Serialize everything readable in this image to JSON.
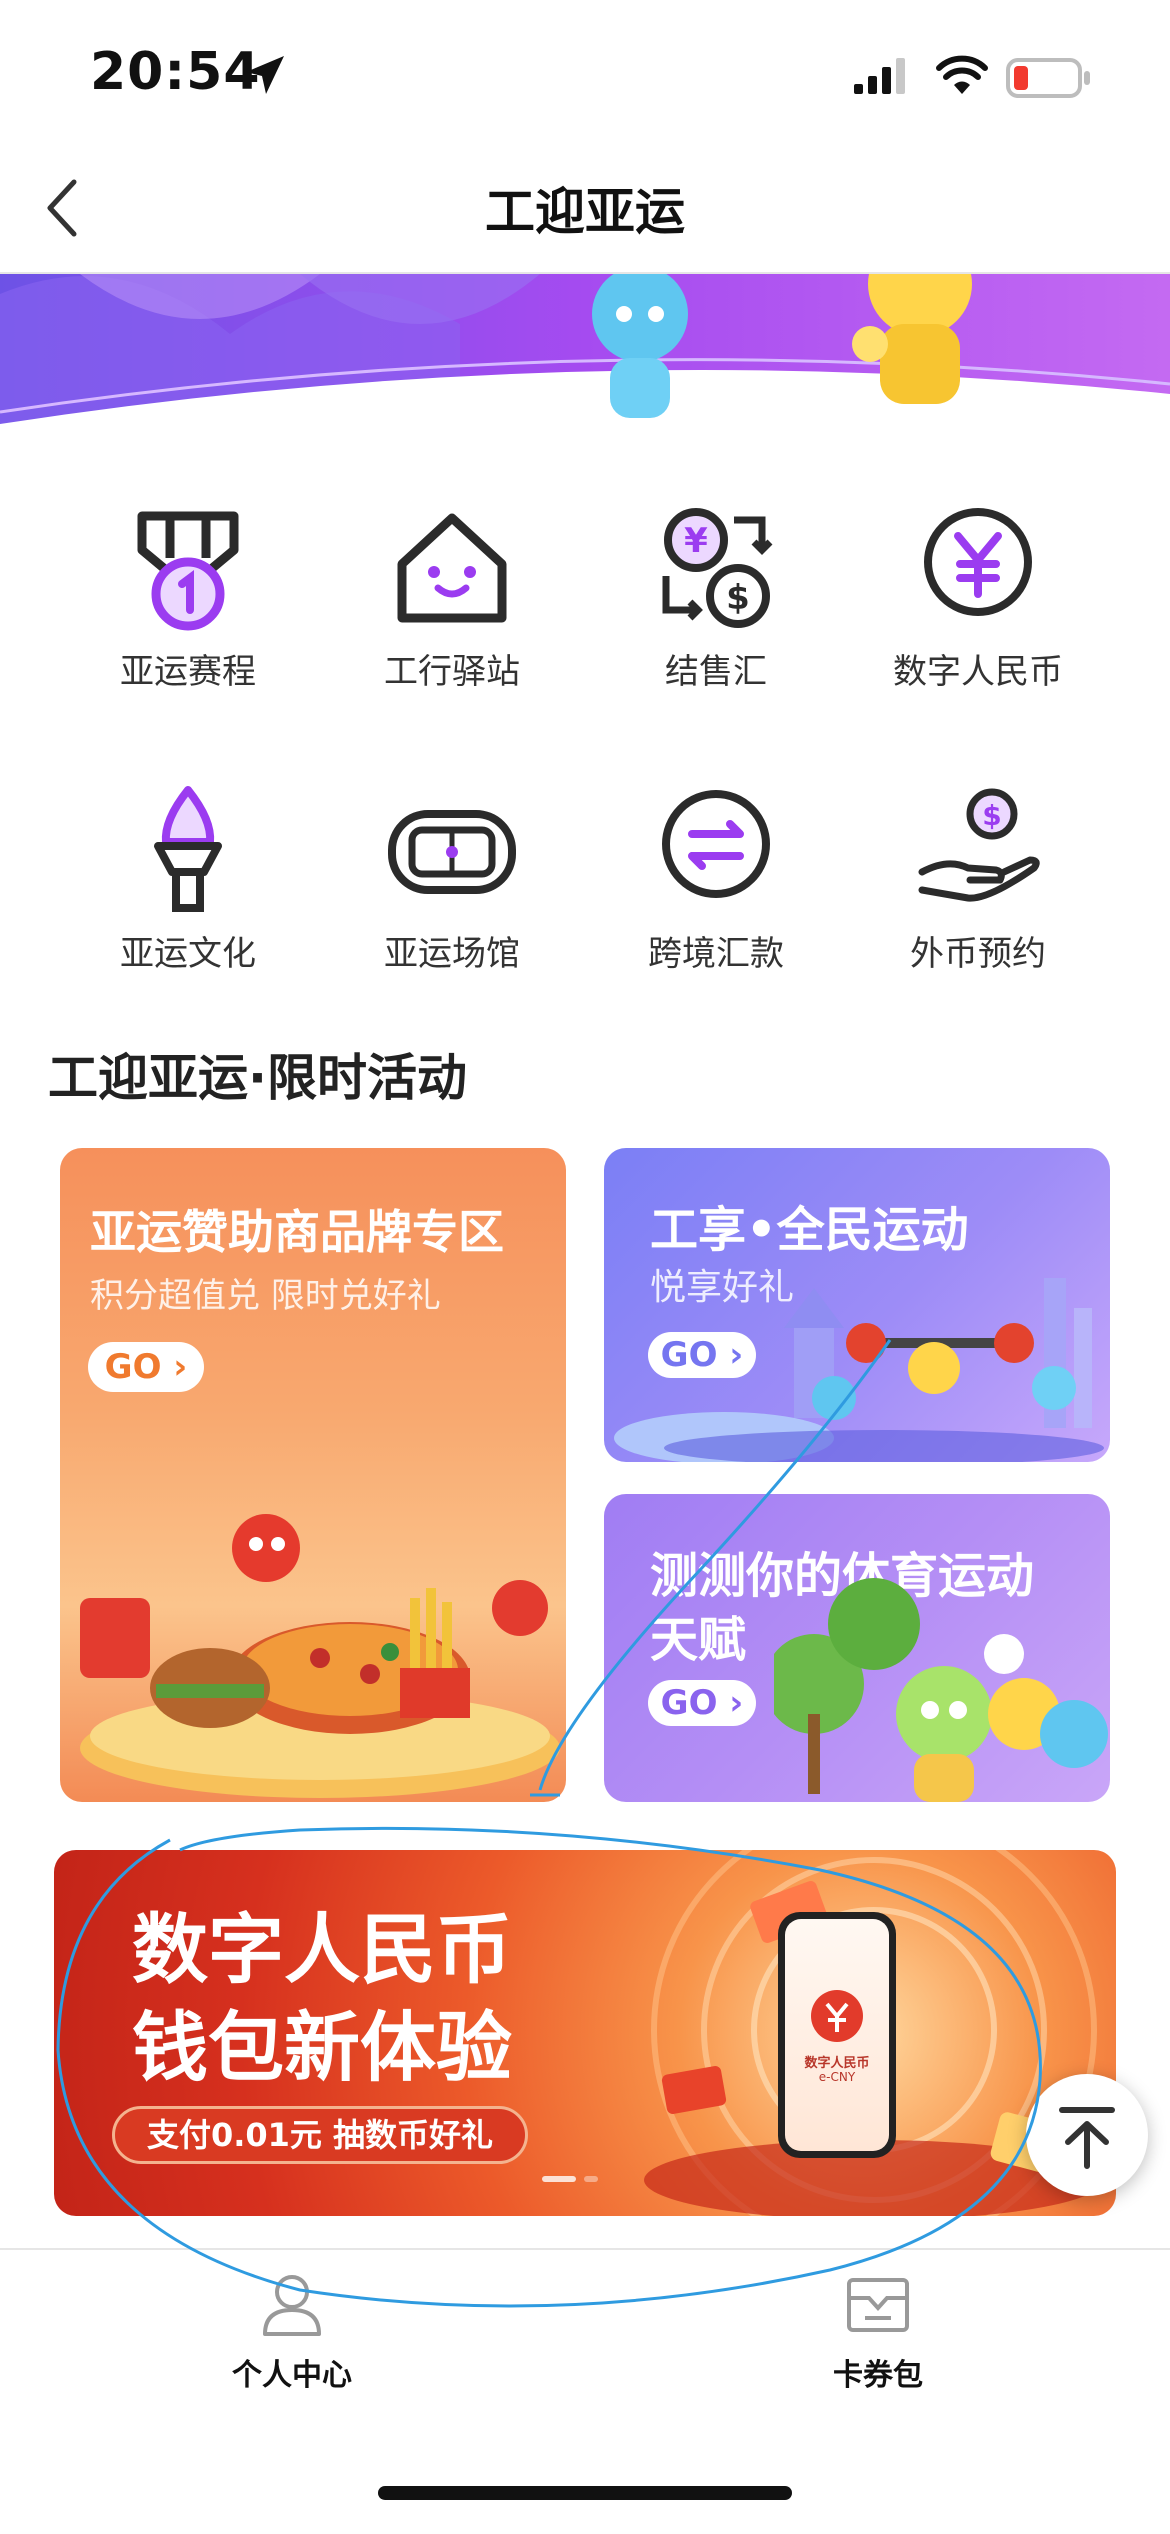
{
  "status_bar": {
    "time": "20:54"
  },
  "nav": {
    "title": "工迎亚运"
  },
  "grid": [
    {
      "label": "亚运赛程",
      "icon": "medal-icon"
    },
    {
      "label": "工行驿站",
      "icon": "house-icon"
    },
    {
      "label": "结售汇",
      "icon": "currency-exchange-icon"
    },
    {
      "label": "数字人民币",
      "icon": "yuan-coin-icon"
    },
    {
      "label": "亚运文化",
      "icon": "torch-icon"
    },
    {
      "label": "亚运场馆",
      "icon": "stadium-icon"
    },
    {
      "label": "跨境汇款",
      "icon": "transfer-arrows-icon"
    },
    {
      "label": "外币预约",
      "icon": "hand-coin-icon"
    }
  ],
  "activities": {
    "title": "工迎亚运·限时活动",
    "card_sponsor": {
      "title": "亚运赞助商品牌专区",
      "subtitle": "积分超值兑 限时兑好礼",
      "go": "GO ›"
    },
    "card_sports": {
      "title": "工享•全民运动",
      "subtitle": "悦享好礼",
      "go": "GO ›"
    },
    "card_quiz": {
      "title_line1": "测测你的体育运动",
      "title_line2": "天赋",
      "go": "GO ›"
    }
  },
  "ecny_banner": {
    "title_line1": "数字人民币",
    "title_line2": "钱包新体验",
    "pill": "支付0.01元  抽数币好礼",
    "phone_text": "数字人民币",
    "phone_sub": "e-CNY"
  },
  "tabbar": [
    {
      "label": "个人中心",
      "icon": "person-icon"
    },
    {
      "label": "卡券包",
      "icon": "coupon-icon"
    }
  ],
  "colors": {
    "purple": "#9b3cf0",
    "dark_icon": "#2b2b2b",
    "banner_red": "#e0331f"
  }
}
